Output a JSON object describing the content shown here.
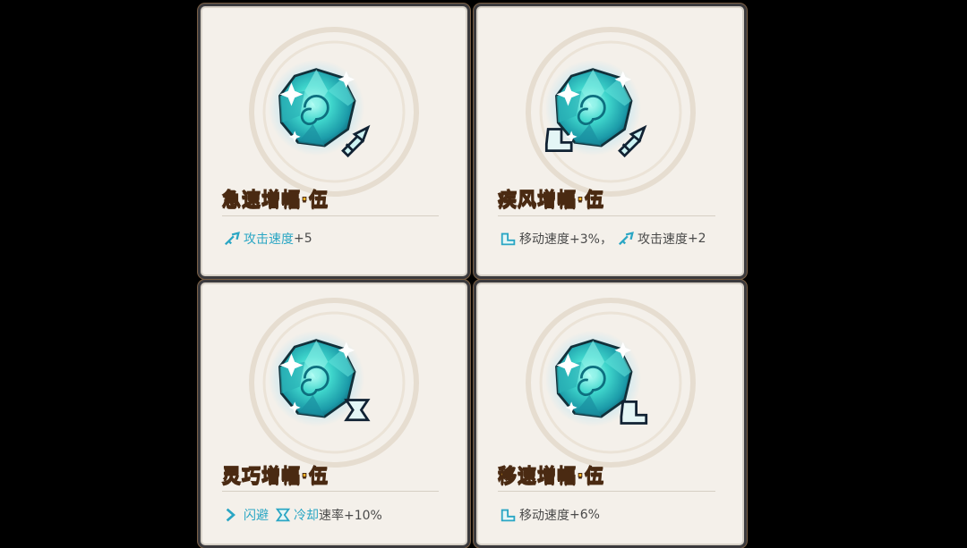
{
  "cards": [
    {
      "title": "急速增幅·伍",
      "stats": [
        {
          "icon": "sword-icon",
          "label": "攻击速度",
          "value": "+5"
        }
      ]
    },
    {
      "title": "疾风增幅·伍",
      "stats": [
        {
          "icon": "boot-icon",
          "label": "移动速度",
          "value": "+3%，"
        },
        {
          "icon": "sword-icon",
          "label": "攻击速度",
          "value": "+2"
        }
      ]
    },
    {
      "title": "灵巧增幅·伍",
      "stats": [
        {
          "icon": "dodge-icon",
          "label": "闪避",
          "value": ""
        },
        {
          "icon": "hourglass-icon",
          "label": "冷却",
          "value": "速率+10%"
        }
      ]
    },
    {
      "title": "移速增幅·伍",
      "stats": [
        {
          "icon": "boot-icon",
          "label": "移动速度",
          "value": "+6%"
        }
      ]
    }
  ],
  "colors": {
    "title": "#f3b324",
    "title_outline": "#4a2a12",
    "gem": "#39d0c8",
    "stat_icon": "#2aa6c4",
    "card_bg": "#f4f0ea"
  }
}
